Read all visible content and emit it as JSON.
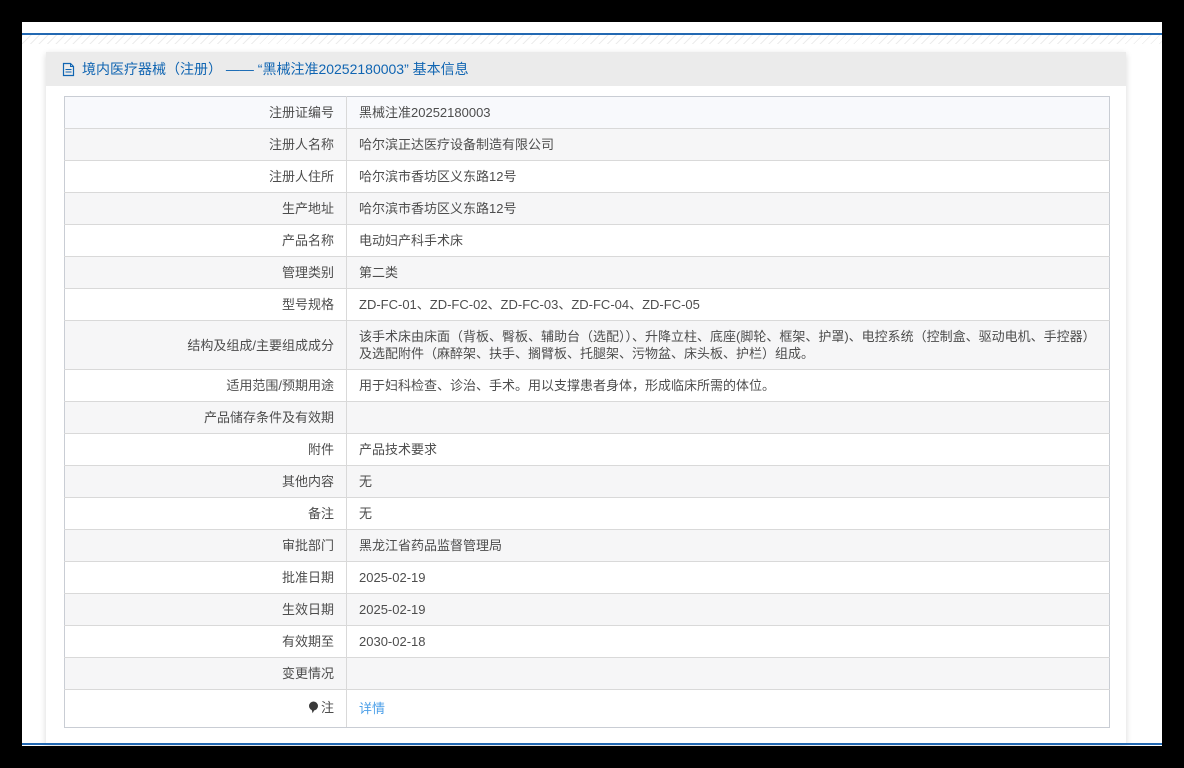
{
  "header": {
    "icon": "document-icon",
    "title": "境内医疗器械（注册） —— “黑械注准20252180003” 基本信息"
  },
  "table": {
    "rows": [
      {
        "label": "注册证编号",
        "value": "黑械注准20252180003"
      },
      {
        "label": "注册人名称",
        "value": "哈尔滨正达医疗设备制造有限公司"
      },
      {
        "label": "注册人住所",
        "value": "哈尔滨市香坊区义东路12号"
      },
      {
        "label": "生产地址",
        "value": "哈尔滨市香坊区义东路12号"
      },
      {
        "label": "产品名称",
        "value": "电动妇产科手术床"
      },
      {
        "label": "管理类别",
        "value": "第二类"
      },
      {
        "label": "型号规格",
        "value": "ZD-FC-01、ZD-FC-02、ZD-FC-03、ZD-FC-04、ZD-FC-05"
      },
      {
        "label": "结构及组成/主要组成成分",
        "value": "该手术床由床面（背板、臀板、辅助台（选配））、升降立柱、底座(脚轮、框架、护罩)、电控系统（控制盒、驱动电机、手控器）及选配附件（麻醉架、扶手、搁臂板、托腿架、污物盆、床头板、护栏）组成。"
      },
      {
        "label": "适用范围/预期用途",
        "value": "用于妇科检查、诊治、手术。用以支撑患者身体，形成临床所需的体位。"
      },
      {
        "label": "产品储存条件及有效期",
        "value": ""
      },
      {
        "label": "附件",
        "value": "产品技术要求"
      },
      {
        "label": "其他内容",
        "value": "无"
      },
      {
        "label": "备注",
        "value": "无"
      },
      {
        "label": "审批部门",
        "value": "黑龙江省药品监督管理局"
      },
      {
        "label": "批准日期",
        "value": "2025-02-19"
      },
      {
        "label": "生效日期",
        "value": "2025-02-19"
      },
      {
        "label": "有效期至",
        "value": "2030-02-18"
      },
      {
        "label": "变更情况",
        "value": ""
      },
      {
        "label": "注",
        "icon": "bulb-icon",
        "link_label": "详情"
      }
    ]
  },
  "colors": {
    "accent_blue": "#1065b2",
    "link_blue": "#4c9fe8",
    "line_blue": "#2268b2",
    "header_bar_bg": "#ebebeb"
  }
}
